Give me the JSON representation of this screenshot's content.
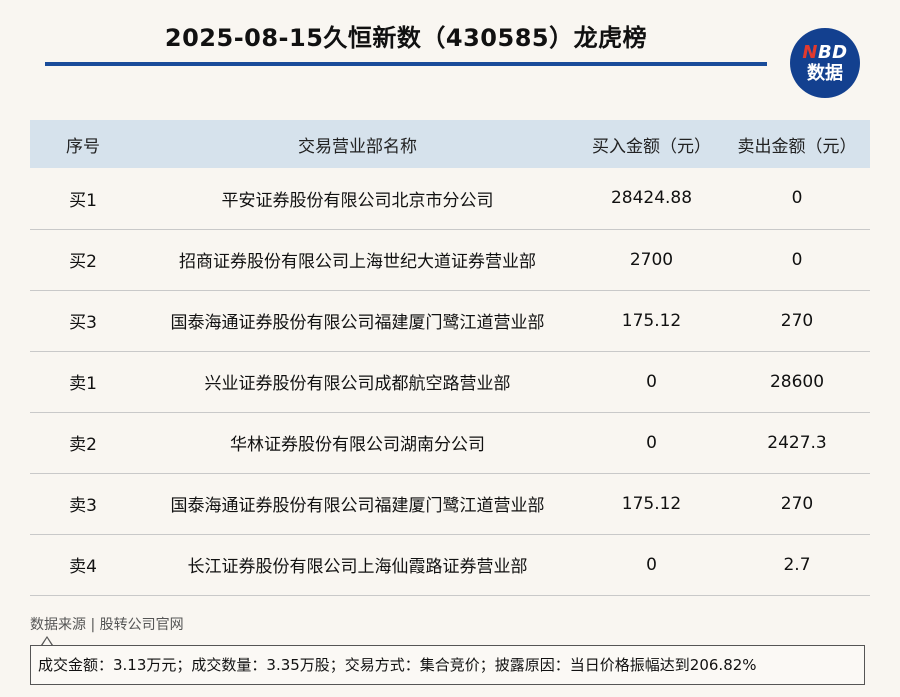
{
  "header": {
    "title": "2025-08-15久恒新数（430585）龙虎榜",
    "logo_top": "NBD",
    "logo_top_accent": "N",
    "logo_top_rest": "BD",
    "logo_bottom": "数据"
  },
  "table": {
    "columns": [
      "序号",
      "交易营业部名称",
      "买入金额（元）",
      "卖出金额（元）"
    ],
    "rows": [
      {
        "index": "买1",
        "name": "平安证券股份有限公司北京市分公司",
        "buy": "28424.88",
        "sell": "0"
      },
      {
        "index": "买2",
        "name": "招商证券股份有限公司上海世纪大道证券营业部",
        "buy": "2700",
        "sell": "0"
      },
      {
        "index": "买3",
        "name": "国泰海通证券股份有限公司福建厦门鹭江道营业部",
        "buy": "175.12",
        "sell": "270"
      },
      {
        "index": "卖1",
        "name": "兴业证券股份有限公司成都航空路营业部",
        "buy": "0",
        "sell": "28600"
      },
      {
        "index": "卖2",
        "name": "华林证券股份有限公司湖南分公司",
        "buy": "0",
        "sell": "2427.3"
      },
      {
        "index": "卖3",
        "name": "国泰海通证券股份有限公司福建厦门鹭江道营业部",
        "buy": "175.12",
        "sell": "270"
      },
      {
        "index": "卖4",
        "name": "长江证券股份有限公司上海仙霞路证券营业部",
        "buy": "0",
        "sell": "2.7"
      }
    ]
  },
  "footer": {
    "source": "数据来源 | 股转公司官网",
    "note": "成交金额：3.13万元；成交数量：3.35万股；交易方式：集合竞价；披露原因：当日价格振幅达到206.82%"
  },
  "colors": {
    "accent": "#1a4c9a",
    "logo_bg": "#13408f",
    "logo_red": "#e23a2e",
    "header_row_bg": "#d6e2ec",
    "page_bg": "#f9f6f1"
  }
}
